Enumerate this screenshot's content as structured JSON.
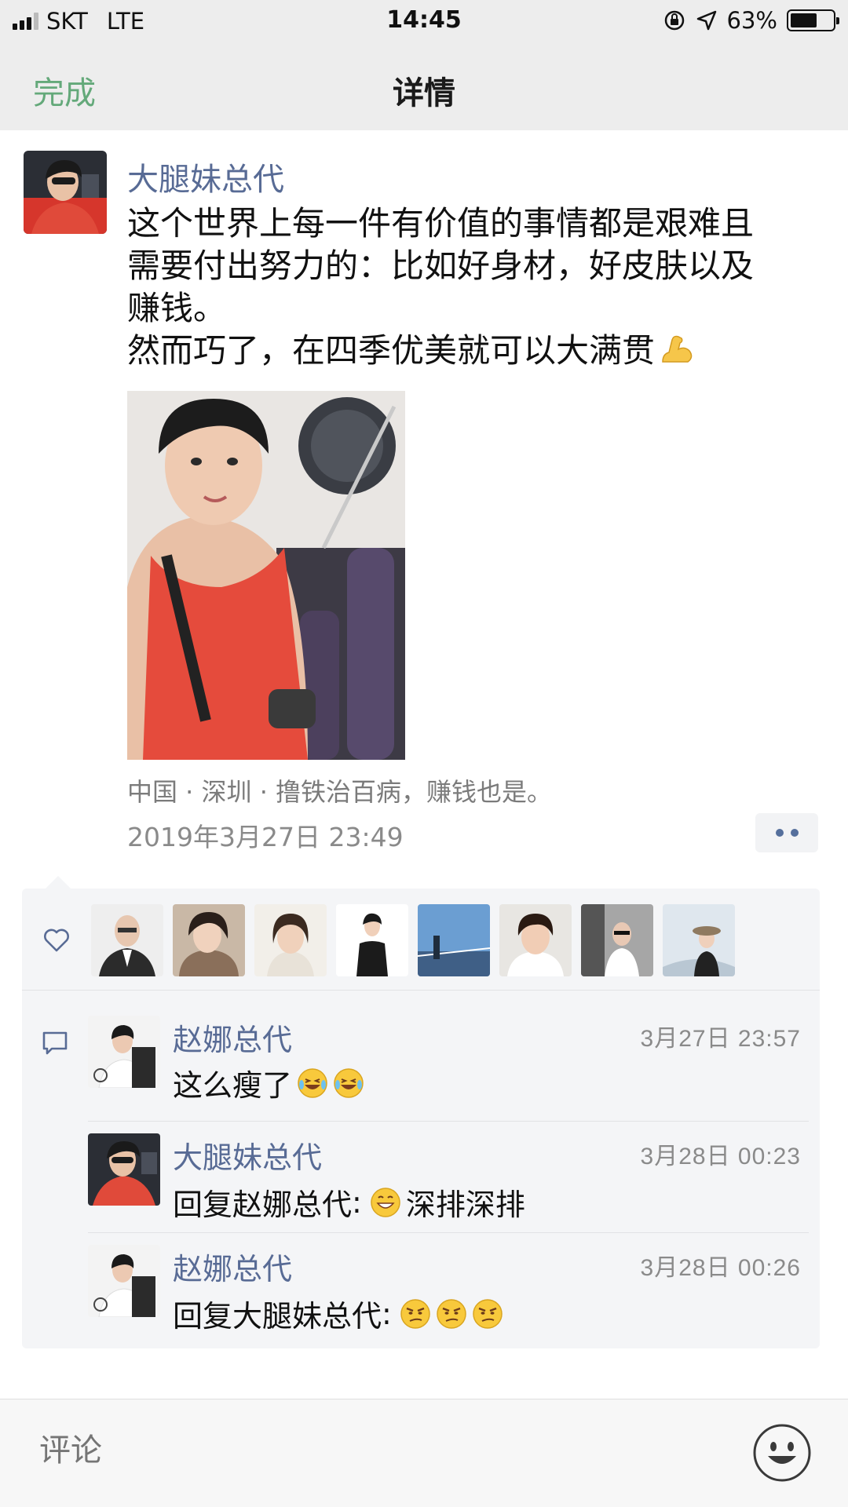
{
  "status_bar": {
    "carrier": "SKT",
    "network": "LTE",
    "time": "14:45",
    "battery": "63%",
    "battery_level": 0.63
  },
  "nav": {
    "done_label": "完成",
    "title": "详情"
  },
  "post": {
    "author": "大腿妹总代",
    "text": "这个世界上每一件有价值的事情都是艰难且\n需要付出努力的：比如好身材，好皮肤以及\n赚钱。\n然而巧了，在四季优美就可以大满贯",
    "text_emoji": "flexed-biceps-emoji",
    "location": "中国 · 深圳 · 撸铁治百病，赚钱也是。",
    "time": "2019年3月27日 23:49"
  },
  "likes": {
    "icon": "heart-icon",
    "avatars": [
      "liker-avatar-1",
      "liker-avatar-2",
      "liker-avatar-3",
      "liker-avatar-4",
      "liker-avatar-5",
      "liker-avatar-6",
      "liker-avatar-7",
      "liker-avatar-8"
    ]
  },
  "comments": [
    {
      "author": "赵娜总代",
      "time": "3月27日 23:57",
      "text": "这么瘦了",
      "emojis": [
        "laughing-tears-emoji",
        "laughing-tears-emoji"
      ]
    },
    {
      "author": "大腿妹总代",
      "time": "3月28日 00:23",
      "reply_prefix": "回复",
      "reply_to": "赵娜总代",
      "reply_sep": ":",
      "emojis_before": [
        "grinning-emoji"
      ],
      "text": "深排深排"
    },
    {
      "author": "赵娜总代",
      "time": "3月28日 00:26",
      "reply_prefix": "回复",
      "reply_to": "大腿妹总代",
      "reply_sep": ":",
      "emojis": [
        "smirk-emoji",
        "smirk-emoji",
        "smirk-emoji"
      ]
    }
  ],
  "input": {
    "placeholder": "评论",
    "emoji_button": "smiley-face-icon"
  },
  "colors": {
    "link": "#586b95",
    "accent_done": "#64a97a",
    "bar_bg": "#ededed"
  }
}
